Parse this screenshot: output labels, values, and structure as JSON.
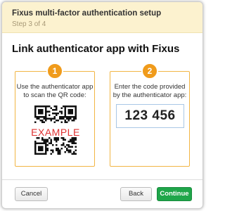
{
  "header": {
    "title": "Fixus multi-factor authentication setup",
    "step": "Step 3 of 4"
  },
  "main": {
    "title": "Link authenticator app with Fixus"
  },
  "steps": [
    {
      "number": "1",
      "instruction_line1": "Use the authenticator app",
      "instruction_line2": "to scan the QR code:",
      "qr_overlay_text": "EXAMPLE"
    },
    {
      "number": "2",
      "instruction_line1": "Enter the code provided",
      "instruction_line2": "by the authenticator app:",
      "code_value": "123 456"
    }
  ],
  "footer": {
    "cancel_label": "Cancel",
    "back_label": "Back",
    "continue_label": "Continue"
  },
  "colors": {
    "header_bg": "#fcf2cf",
    "accent_orange": "#f09b1b",
    "panel_border": "#f2b544",
    "example_red": "#e03030",
    "continue_green": "#1fa64a"
  },
  "icons": {
    "qr": "qr-code-icon"
  }
}
